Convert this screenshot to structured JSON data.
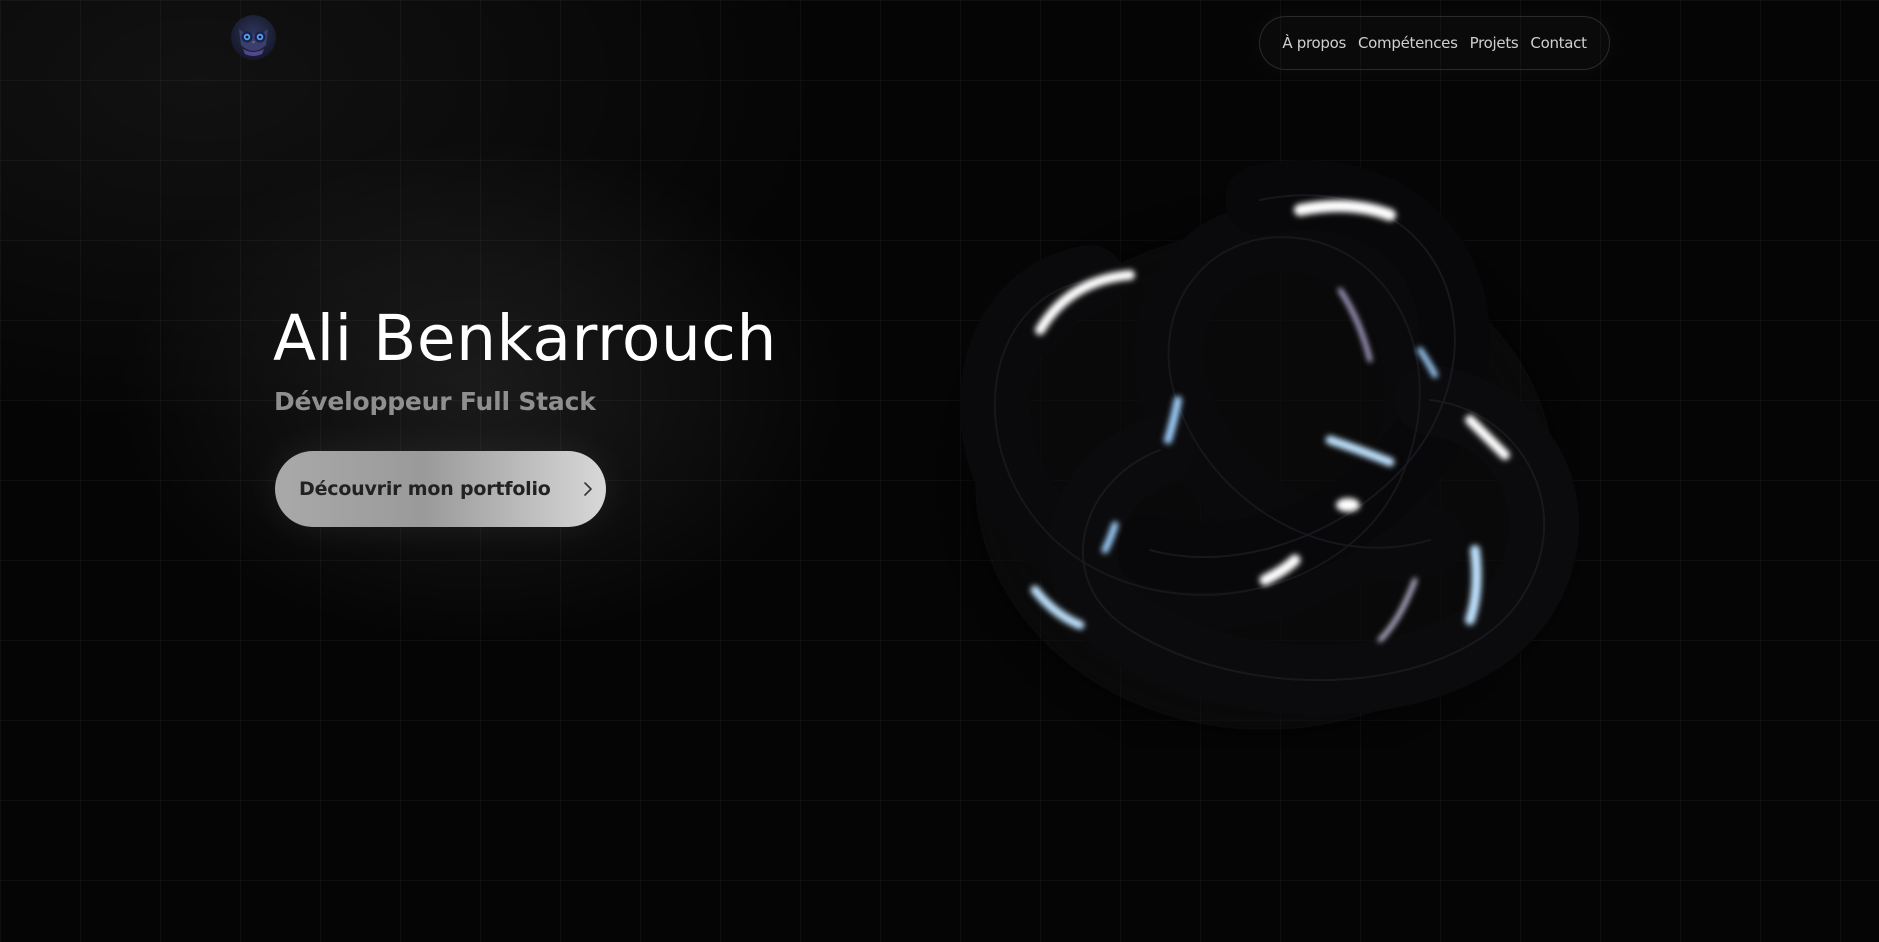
{
  "header": {
    "logo_icon": "owl-avatar-icon"
  },
  "nav": {
    "items": [
      {
        "label": "À propos"
      },
      {
        "label": "Compétences"
      },
      {
        "label": "Projets"
      },
      {
        "label": "Contact"
      }
    ]
  },
  "hero": {
    "title": "Ali Benkarrouch",
    "subtitle": "Développeur Full Stack",
    "cta_label": "Découvrir mon portfolio",
    "cta_icon": "chevron-right-icon"
  },
  "visual": {
    "icon": "3d-torus-knot"
  },
  "colors": {
    "background": "#050505",
    "accent_highlight": "#bfe3ff",
    "subtitle": "#8f8f8f"
  }
}
